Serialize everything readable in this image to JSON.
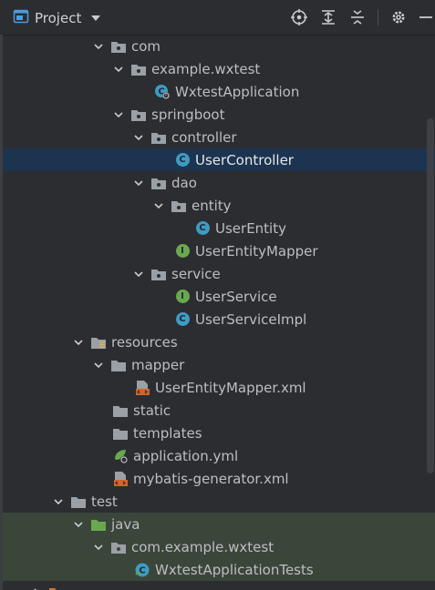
{
  "toolbar": {
    "title": "Project",
    "icons": [
      "project-window-icon",
      "dropdown-arrow-icon",
      "locate-target-icon",
      "expand-all-icon",
      "collapse-all-icon",
      "gear-icon",
      "minimize-icon"
    ]
  },
  "tree": {
    "com": "com",
    "example_wxtest": "example.wxtest",
    "wxtest_application": "WxtestApplication",
    "springboot": "springboot",
    "controller": "controller",
    "user_controller": "UserController",
    "dao": "dao",
    "entity": "entity",
    "user_entity": "UserEntity",
    "user_entity_mapper": "UserEntityMapper",
    "service": "service",
    "user_service": "UserService",
    "user_service_impl": "UserServiceImpl",
    "resources": "resources",
    "mapper": "mapper",
    "user_entity_mapper_xml": "UserEntityMapper.xml",
    "static": "static",
    "templates": "templates",
    "application_yml": "application.yml",
    "mybatis_generator_xml": "mybatis-generator.xml",
    "test": "test",
    "java": "java",
    "com_example_wxtest": "com.example.wxtest",
    "wxtest_application_tests": "WxtestApplicationTests"
  },
  "colors": {
    "background": "#2b2d30",
    "selected_row": "#1d3450",
    "test_row": "#3b463a",
    "class_icon": "#3e9bc4",
    "interface_icon": "#6aa84f",
    "xml_icon": "#d1652c"
  }
}
